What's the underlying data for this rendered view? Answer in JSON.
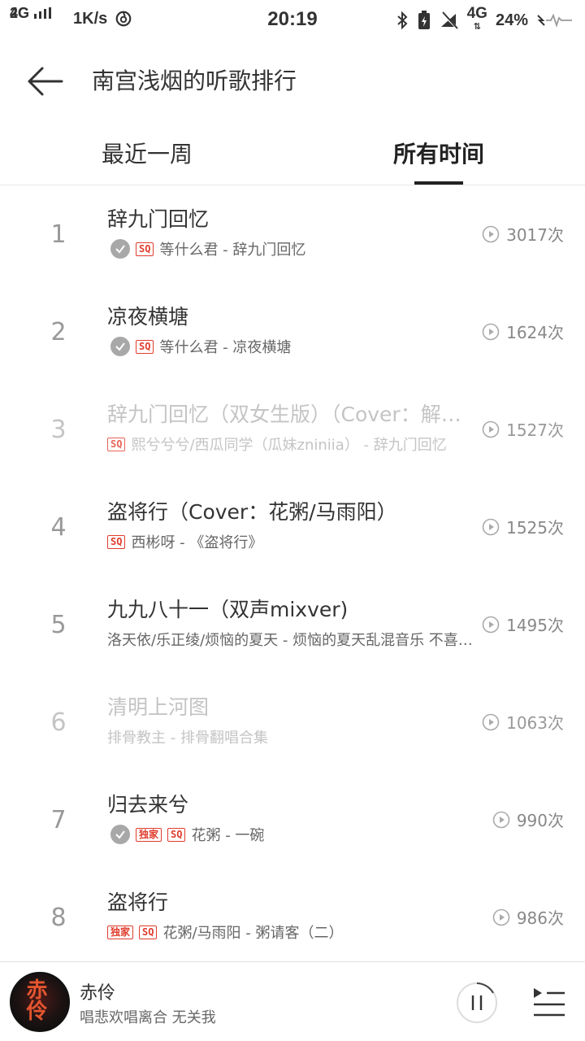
{
  "status_bar": {
    "net_top": "4G",
    "net_bottom": "2G",
    "speed": "1K/s",
    "time": "20:19",
    "net_right": "4G",
    "battery": "24%"
  },
  "header": {
    "title": "南宫浅烟的听歌排行"
  },
  "tabs": [
    {
      "label": "最近一周",
      "active": false
    },
    {
      "label": "所有时间",
      "active": true
    }
  ],
  "songs": [
    {
      "rank": "1",
      "title": "辞九门回忆",
      "meta": "等什么君 - 辞九门回忆",
      "plays": "3017次",
      "downloaded": true,
      "exclusive": false,
      "sq": true,
      "dimmed": false
    },
    {
      "rank": "2",
      "title": "凉夜横塘",
      "meta": "等什么君 - 凉夜横塘",
      "plays": "1624次",
      "downloaded": true,
      "exclusive": false,
      "sq": true,
      "dimmed": false
    },
    {
      "rank": "3",
      "title": "辞九门回忆（双女生版）（Cover：解忧...",
      "meta": "熙兮兮兮/西瓜同学（瓜妹zniniia） - 辞九门回忆",
      "plays": "1527次",
      "downloaded": false,
      "exclusive": false,
      "sq": true,
      "dimmed": true
    },
    {
      "rank": "4",
      "title": "盗将行（Cover：花粥/马雨阳）",
      "meta": "西彬呀 - 《盗将行》",
      "plays": "1525次",
      "downloaded": false,
      "exclusive": false,
      "sq": true,
      "dimmed": false
    },
    {
      "rank": "5",
      "title": "九九八十一（双声mixver)",
      "meta": "洛天依/乐正绫/烦恼的夏天 - 烦恼的夏天乱混音乐 不喜勿...",
      "plays": "1495次",
      "downloaded": false,
      "exclusive": false,
      "sq": false,
      "dimmed": false
    },
    {
      "rank": "6",
      "title": "清明上河图",
      "meta": "排骨教主 - 排骨翻唱合集",
      "plays": "1063次",
      "downloaded": false,
      "exclusive": false,
      "sq": false,
      "dimmed": true
    },
    {
      "rank": "7",
      "title": "归去来兮",
      "meta": "花粥 - 一碗",
      "plays": "990次",
      "downloaded": true,
      "exclusive": true,
      "sq": true,
      "dimmed": false
    },
    {
      "rank": "8",
      "title": "盗将行",
      "meta": "花粥/马雨阳 - 粥请客（二）",
      "plays": "986次",
      "downloaded": false,
      "exclusive": true,
      "sq": true,
      "dimmed": false
    }
  ],
  "tags": {
    "sq": "SQ",
    "exclusive": "独家"
  },
  "player": {
    "cover_text": "赤伶",
    "title": "赤伶",
    "subtitle": "唱悲欢唱离合 无关我"
  },
  "colors": {
    "accent": "#e03c2d",
    "text": "#333333",
    "muted": "#888888"
  }
}
